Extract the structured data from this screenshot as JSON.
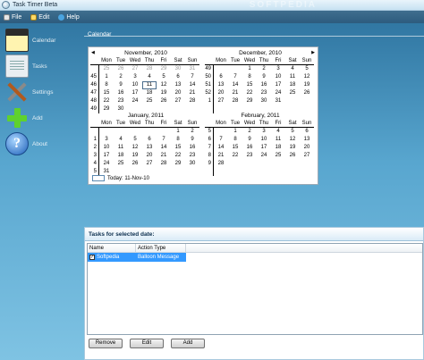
{
  "window": {
    "title": "Task Timer Beta",
    "watermark": "SOFTPEDIA"
  },
  "menu": {
    "file": "File",
    "edit": "Edit",
    "help": "Help"
  },
  "sidebar": {
    "items": [
      {
        "label": "Calendar",
        "icon": "calendar-icon"
      },
      {
        "label": "Tasks",
        "icon": "tasks-icon"
      },
      {
        "label": "Settings",
        "icon": "settings-icon"
      },
      {
        "label": "Add",
        "icon": "add-icon"
      },
      {
        "label": "About",
        "icon": "about-icon"
      }
    ]
  },
  "calendar": {
    "caption": "Calendar",
    "dow": [
      "Mon",
      "Tue",
      "Wed",
      "Thu",
      "Fri",
      "Sat",
      "Sun"
    ],
    "today_label": "Today: 11-Nov-10",
    "months": [
      {
        "title": "November, 2010",
        "rows": [
          [
            "",
            "25",
            "26",
            "27",
            "28",
            "29",
            "30",
            "31"
          ],
          [
            "45",
            "1",
            "2",
            "3",
            "4",
            "5",
            "6",
            "7"
          ],
          [
            "46",
            "8",
            "9",
            "10",
            "11",
            "12",
            "13",
            "14"
          ],
          [
            "47",
            "15",
            "16",
            "17",
            "18",
            "19",
            "20",
            "21"
          ],
          [
            "48",
            "22",
            "23",
            "24",
            "25",
            "26",
            "27",
            "28"
          ],
          [
            "49",
            "29",
            "30",
            "",
            "",
            "",
            "",
            ""
          ]
        ]
      },
      {
        "title": "December, 2010",
        "rows": [
          [
            "49",
            "",
            "",
            "1",
            "2",
            "3",
            "4",
            "5"
          ],
          [
            "50",
            "6",
            "7",
            "8",
            "9",
            "10",
            "11",
            "12"
          ],
          [
            "51",
            "13",
            "14",
            "15",
            "16",
            "17",
            "18",
            "19"
          ],
          [
            "52",
            "20",
            "21",
            "22",
            "23",
            "24",
            "25",
            "26"
          ],
          [
            "1",
            "27",
            "28",
            "29",
            "30",
            "31",
            "",
            ""
          ],
          [
            "",
            "",
            "",
            "",
            "",
            "",
            "",
            ""
          ]
        ]
      },
      {
        "title": "January, 2011",
        "rows": [
          [
            "",
            "",
            "",
            "",
            "",
            "",
            "1",
            "2"
          ],
          [
            "1",
            "3",
            "4",
            "5",
            "6",
            "7",
            "8",
            "9"
          ],
          [
            "2",
            "10",
            "11",
            "12",
            "13",
            "14",
            "15",
            "16"
          ],
          [
            "3",
            "17",
            "18",
            "19",
            "20",
            "21",
            "22",
            "23"
          ],
          [
            "4",
            "24",
            "25",
            "26",
            "27",
            "28",
            "29",
            "30"
          ],
          [
            "5",
            "31",
            "",
            "",
            "",
            "",
            "",
            ""
          ]
        ]
      },
      {
        "title": "February, 2011",
        "rows": [
          [
            "5",
            "",
            "1",
            "2",
            "3",
            "4",
            "5",
            "6"
          ],
          [
            "6",
            "7",
            "8",
            "9",
            "10",
            "11",
            "12",
            "13"
          ],
          [
            "7",
            "14",
            "15",
            "16",
            "17",
            "18",
            "19",
            "20"
          ],
          [
            "8",
            "21",
            "22",
            "23",
            "24",
            "25",
            "26",
            "27"
          ],
          [
            "9",
            "28",
            "",
            "",
            "",
            "",
            "",
            ""
          ],
          [
            "",
            "",
            "",
            "",
            "",
            "",
            "",
            ""
          ]
        ]
      }
    ]
  },
  "tasks": {
    "header": "Tasks for selected date:",
    "columns": {
      "name": "Name",
      "action": "Action Type"
    },
    "rows": [
      {
        "name": "Softpedia",
        "action": "Balloon Message",
        "checked": true
      }
    ],
    "buttons": {
      "remove": "Remove",
      "edit": "Edit",
      "add": "Add"
    }
  }
}
